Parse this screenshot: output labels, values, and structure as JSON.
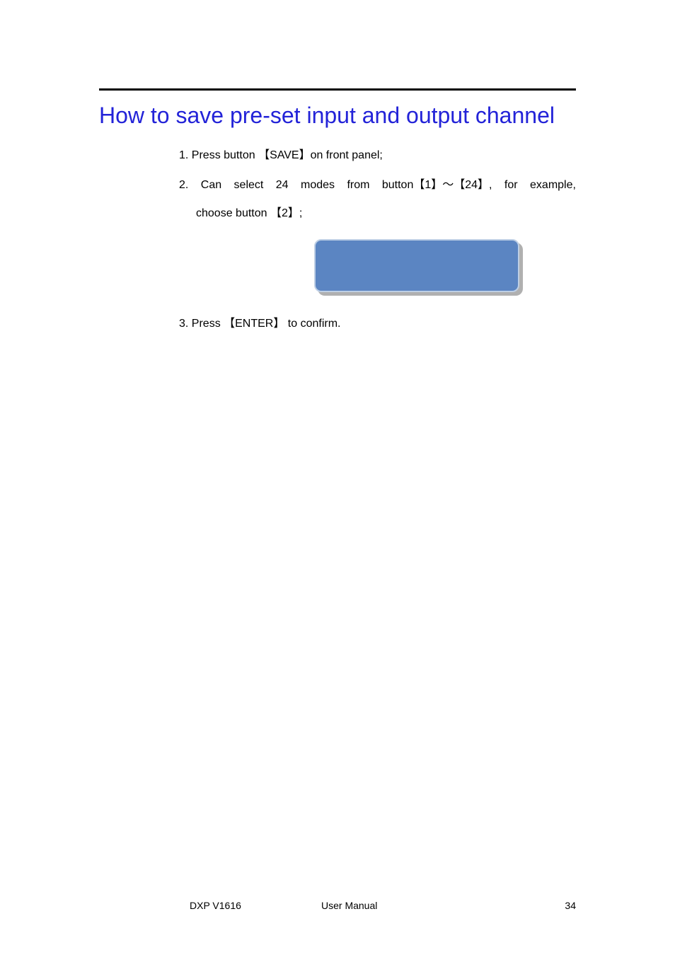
{
  "title": "How to save pre-set input and output channel",
  "steps": {
    "s1": "1. Press button 【SAVE】on front panel;",
    "s2_line1": "2. Can select 24 modes from button【1】～【24】, for example,",
    "s2_line2": "choose button 【2】;",
    "s3": "3. Press 【ENTER】 to confirm."
  },
  "footer": {
    "product": "DXP V1616",
    "doc_type": "User Manual",
    "page_number": "34"
  }
}
